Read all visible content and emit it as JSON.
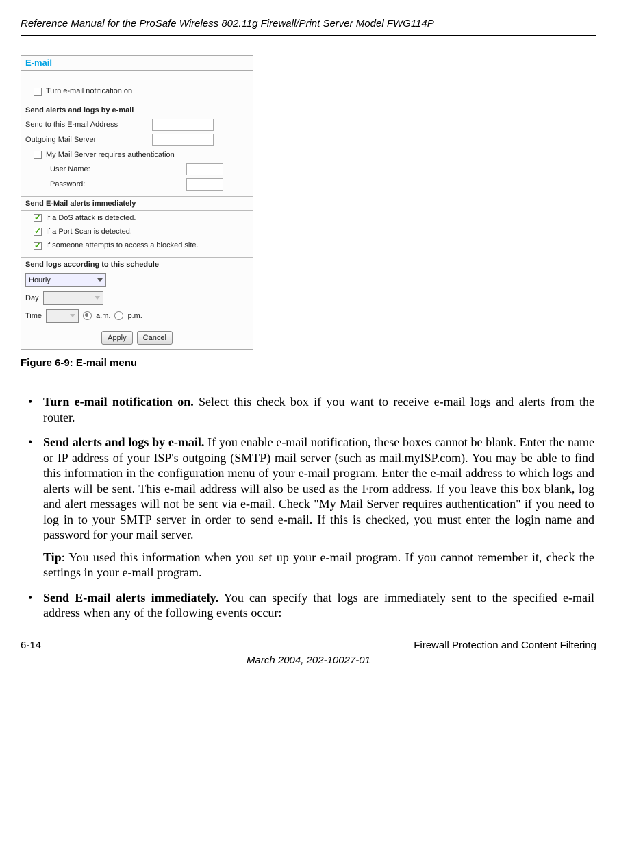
{
  "header": {
    "title": "Reference Manual for the ProSafe Wireless 802.11g  Firewall/Print Server Model FWG114P"
  },
  "figure": {
    "panel_title": "E-mail",
    "notify_on_label": "Turn e-mail notification on",
    "section_send_alerts": "Send alerts and logs by e-mail",
    "send_to_label": "Send to this E-mail Address",
    "outgoing_label": "Outgoing Mail Server",
    "auth_label": "My Mail Server requires authentication",
    "user_label": "User Name:",
    "pass_label": "Password:",
    "section_immediate": "Send E-Mail alerts immediately",
    "alert_dos": "If a DoS attack is detected.",
    "alert_portscan": "If a Port Scan is detected.",
    "alert_blocked": "If someone attempts to access a blocked site.",
    "section_schedule": "Send logs according to this schedule",
    "schedule_freq": "Hourly",
    "schedule_day_label": "Day",
    "schedule_time_label": "Time",
    "am_label": "a.m.",
    "pm_label": "p.m.",
    "btn_apply": "Apply",
    "btn_cancel": "Cancel",
    "caption": "Figure 6-9:  E-mail menu"
  },
  "body": {
    "b1": {
      "lead": "Turn e-mail notification on.",
      "text": " Select this check box if you want to receive e-mail logs and alerts from the router."
    },
    "b2": {
      "lead": "Send alerts and logs by e-mail.",
      "text": " If you enable e-mail notification, these boxes cannot be blank. Enter the name or IP address of your ISP's outgoing (SMTP) mail server (such as mail.myISP.com). You may be able to find this information in the configuration menu of your e-mail program. Enter the e-mail address to which logs and alerts will be sent. This e-mail address will also be used as the From address. If you leave this box blank, log and alert messages will not be sent via e-mail. Check \"My Mail Server requires authentication\" if you need to log in to your SMTP server in order to send e-mail. If this is checked, you must enter the login name and password for your mail server.",
      "tip_lead": "Tip",
      "tip_text": ": You used this information when you set up your e-mail program. If you cannot remember it, check the settings in your e-mail program."
    },
    "b3": {
      "lead": "Send E-mail alerts immediately.",
      "text": " You can specify that logs are immediately sent to the specified e-mail address when any of the following events occur:"
    }
  },
  "footer": {
    "page_number": "6-14",
    "section": "Firewall Protection and Content Filtering",
    "date": "March 2004, 202-10027-01"
  }
}
